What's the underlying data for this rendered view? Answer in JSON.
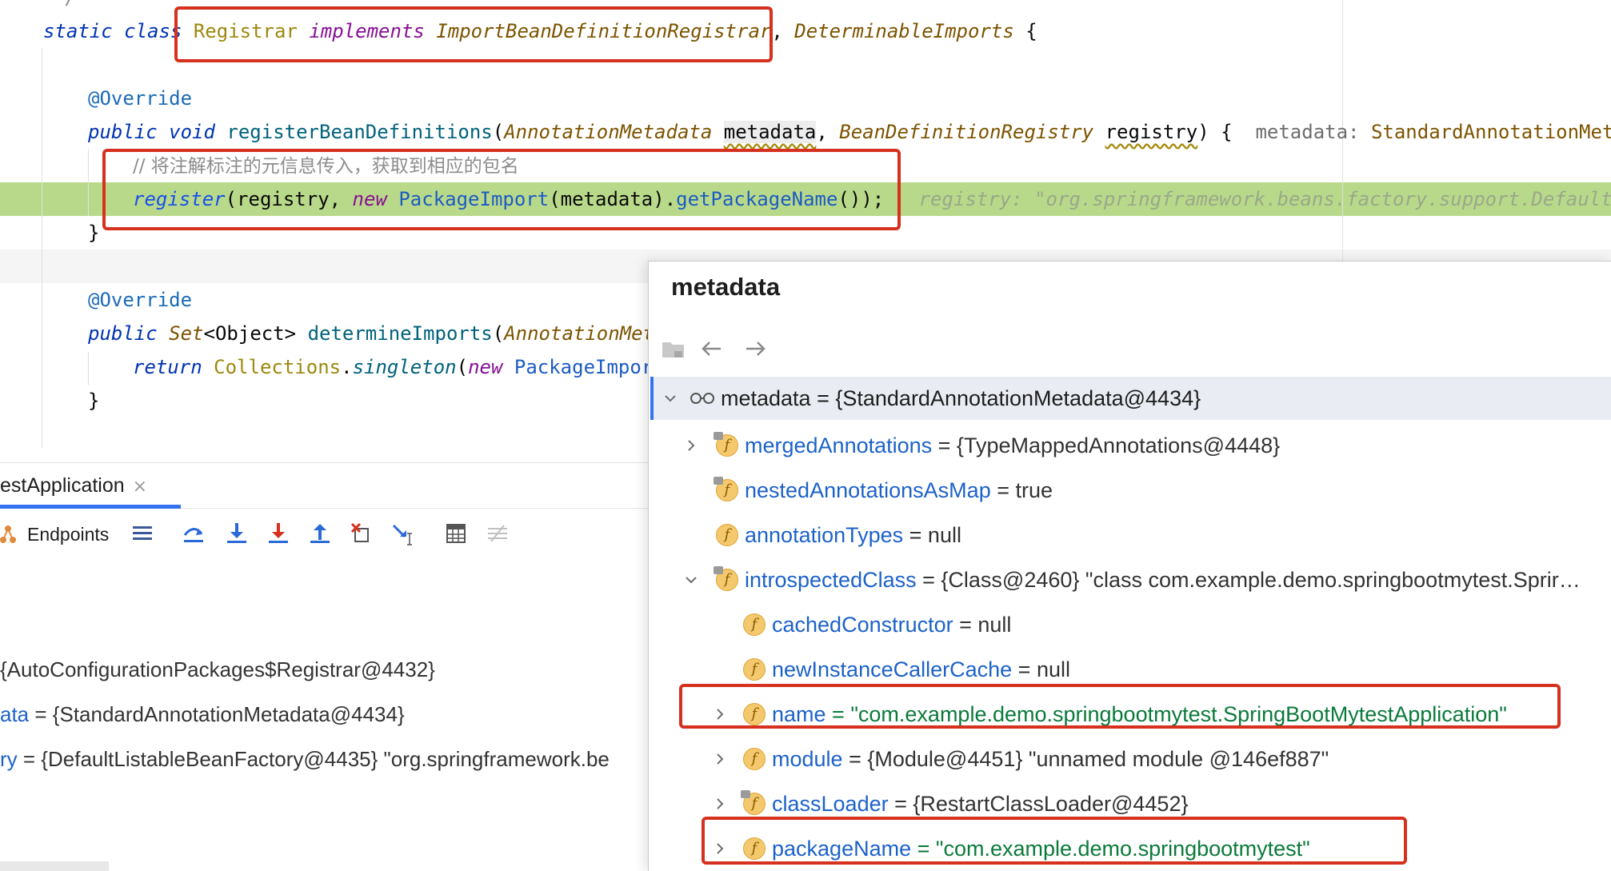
{
  "editor": {
    "code_lines": {
      "l1": {
        "kw1": "static",
        "kw2": "class",
        "cls": "Registrar",
        "impl": "implements",
        "iface1": "ImportBeanDefinitionRegistrar",
        "comma": ",",
        "iface2": "DeterminableImports",
        "brace": " {"
      },
      "l2": {
        "ann": "@Override"
      },
      "l3": {
        "kw1": "public",
        "kw2": "void",
        "fn": "registerBeanDefinitions",
        "p_open": "(",
        "t1": "AnnotationMetadata",
        "a1": "metadata",
        "sep": ", ",
        "t2": "BeanDefinitionRegistry",
        "a2": "registry",
        "close": ") {",
        "hint_label": "metadata: ",
        "hint_value": "StandardAnnotationMetadat"
      },
      "l4": {
        "comment": "// 将注解标注的元信息传入，获取到相应的包名"
      },
      "l5": {
        "fn_call": "register",
        "p1": "(registry, ",
        "kw_new": "new",
        "cls": "PackageImport",
        "p2": "(metadata).",
        "method": "getPackageName",
        "p3": "());",
        "hint": "registry: \"org.springframework.beans.factory.support.DefaultLista"
      },
      "l6": {
        "brace": "}"
      },
      "l7": {
        "ann": "@Override"
      },
      "l8": {
        "kw1": "public",
        "type1": "Set",
        "gen": "<Object>",
        "fn": "determineImports",
        "p_open": "(",
        "t1": "AnnotationMeta"
      },
      "l9": {
        "kw_return": "return",
        "cls": "Collections",
        "dot": ".",
        "method": "singleton",
        "p_open": "(",
        "kw_new": "new",
        "cls2": "PackageImport"
      },
      "l10": {
        "brace": "}"
      }
    }
  },
  "debug": {
    "tab_label": "estApplication",
    "tab_close": "×",
    "toolbar_label": "Endpoints",
    "icons": [
      "endpoints-icon",
      "threads-icon",
      "step-over-icon",
      "step-into-icon",
      "force-step-into-icon",
      "step-out-icon",
      "drop-frame-icon",
      "run-to-cursor-icon",
      "evaluate-icon",
      "trace-icon"
    ],
    "variables": [
      {
        "text": "{AutoConfigurationPackages$Registrar@4432}"
      },
      {
        "name": "ata",
        "value": " = {StandardAnnotationMetadata@4434}"
      },
      {
        "name": "ry",
        "value": " = {DefaultListableBeanFactory@4435} \"org.springframework.be"
      }
    ]
  },
  "popup": {
    "title": "metadata",
    "root": "metadata = {StandardAnnotationMetadata@4434}",
    "rows": [
      {
        "name": "mergedAnnotations",
        "value": " = {TypeMappedAnnotations@4448}"
      },
      {
        "name": "nestedAnnotationsAsMap",
        "value": " = true"
      },
      {
        "name": "annotationTypes",
        "value": " = null"
      },
      {
        "name": "introspectedClass",
        "value": " = {Class@2460} \"class com.example.demo.springbootmytest.Sprir…"
      },
      {
        "name": "cachedConstructor",
        "value": " = null"
      },
      {
        "name": "newInstanceCallerCache",
        "value": " = null"
      },
      {
        "name": "name",
        "value": " = \"com.example.demo.springbootmytest.SpringBootMytestApplication\""
      },
      {
        "name": "module",
        "value": " = {Module@4451} \"unnamed module @146ef887\""
      },
      {
        "name": "classLoader",
        "value": " = {RestartClassLoader@4452}"
      },
      {
        "name": "packageName",
        "value": " = \"com.example.demo.springbootmytest\""
      }
    ],
    "field_badge": "f"
  },
  "colors": {
    "highlight_line": "#b9d98a",
    "accent": "#3574f0",
    "annotation_box": "#d6301e"
  }
}
